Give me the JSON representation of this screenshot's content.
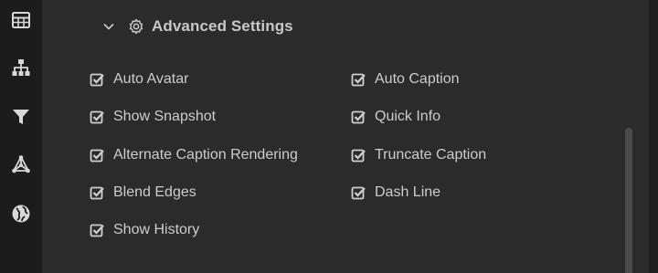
{
  "sidebar": {
    "icons": [
      "table-icon",
      "hierarchy-icon",
      "filter-icon",
      "network-icon",
      "globe-icon"
    ]
  },
  "section": {
    "title": "Advanced Settings",
    "expanded": true
  },
  "options": {
    "left": [
      {
        "label": "Auto Avatar",
        "checked": true
      },
      {
        "label": "Show Snapshot",
        "checked": true
      },
      {
        "label": "Alternate Caption Rendering",
        "checked": true
      },
      {
        "label": "Blend Edges",
        "checked": true
      },
      {
        "label": "Show History",
        "checked": true
      }
    ],
    "right": [
      {
        "label": "Auto Caption",
        "checked": true
      },
      {
        "label": "Quick Info",
        "checked": true
      },
      {
        "label": "Truncate Caption",
        "checked": true
      },
      {
        "label": "Dash Line",
        "checked": true
      }
    ]
  },
  "colors": {
    "background": "#2b2b2b",
    "sidebar": "#1c1c1c",
    "text": "#cdcdcd",
    "icon": "#d8d8d8"
  }
}
